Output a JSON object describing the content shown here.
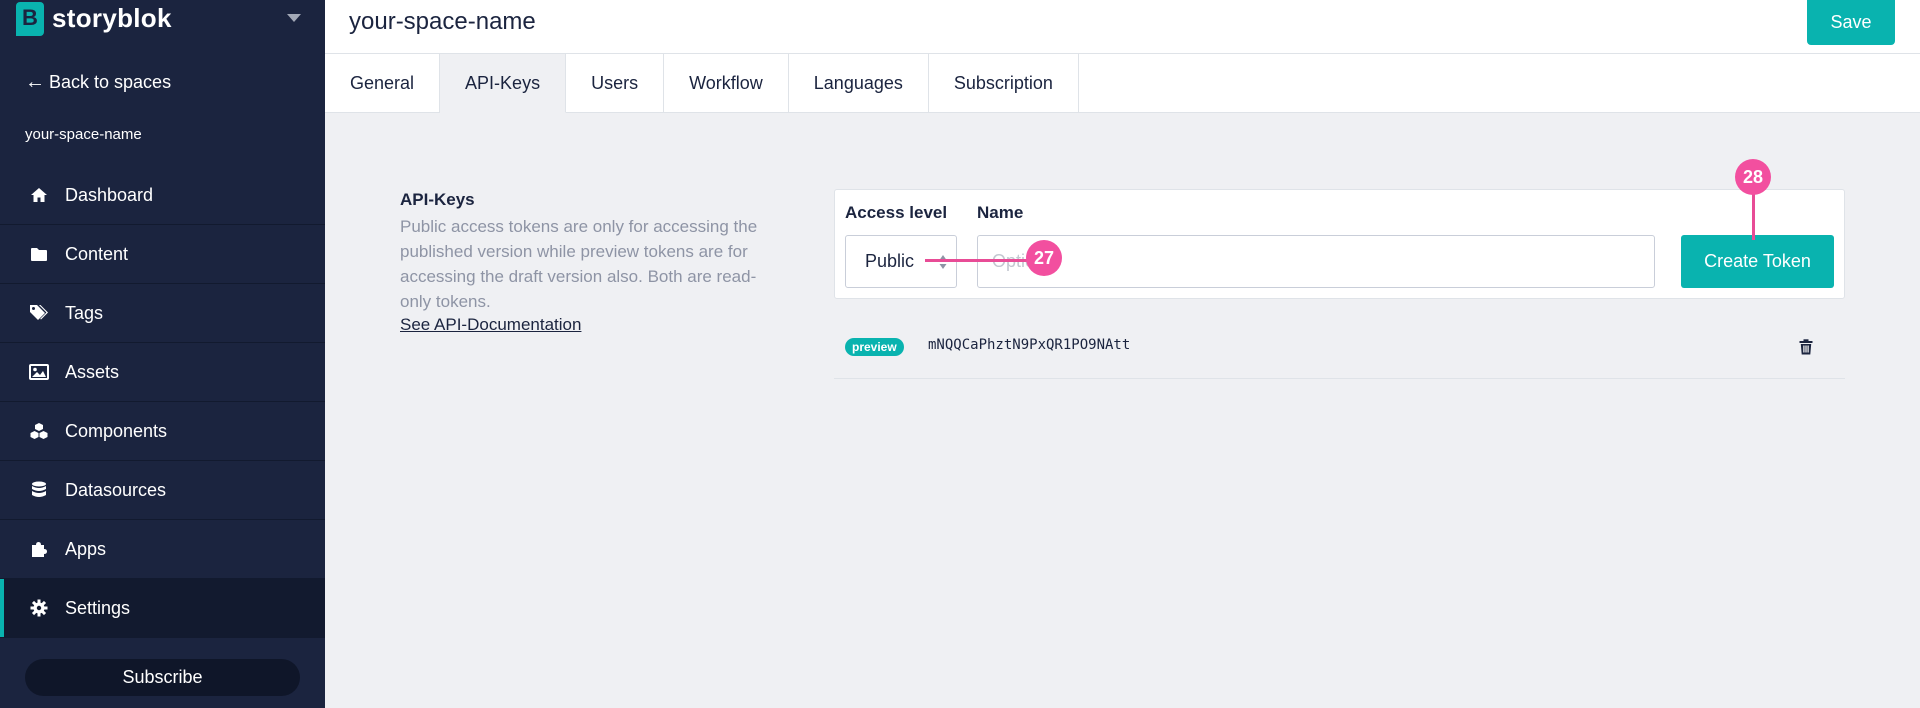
{
  "brand": {
    "name": "storyblok",
    "accent": "#09b3af",
    "sidebar_bg": "#1b243f"
  },
  "sidebar": {
    "back_label": "Back to spaces",
    "space_name": "your-space-name",
    "items": [
      {
        "label": "Dashboard",
        "icon": "home-icon"
      },
      {
        "label": "Content",
        "icon": "folder-icon"
      },
      {
        "label": "Tags",
        "icon": "tags-icon"
      },
      {
        "label": "Assets",
        "icon": "image-icon"
      },
      {
        "label": "Components",
        "icon": "cubes-icon"
      },
      {
        "label": "Datasources",
        "icon": "database-icon"
      },
      {
        "label": "Apps",
        "icon": "puzzle-icon"
      },
      {
        "label": "Settings",
        "icon": "gear-icon",
        "active": true
      }
    ],
    "subscribe_label": "Subscribe"
  },
  "header": {
    "title": "your-space-name",
    "save_label": "Save"
  },
  "tabs": [
    {
      "label": "General"
    },
    {
      "label": "API-Keys",
      "active": true
    },
    {
      "label": "Users"
    },
    {
      "label": "Workflow"
    },
    {
      "label": "Languages"
    },
    {
      "label": "Subscription"
    }
  ],
  "api_keys": {
    "title": "API-Keys",
    "description": "Public access tokens are only for accessing the published version while preview tokens are for accessing the draft version also. Both are read-only tokens.",
    "doc_link": "See API-Documentation",
    "form": {
      "access_level_label": "Access level",
      "access_level_value": "Public",
      "name_label": "Name",
      "name_placeholder": "Optional",
      "name_value": "",
      "create_label": "Create Token"
    },
    "tokens": [
      {
        "badge": "preview",
        "token": "mNQQCaPhztN9PxQR1PO9NAtt"
      }
    ]
  },
  "annotations": [
    {
      "number": "27"
    },
    {
      "number": "28"
    }
  ]
}
